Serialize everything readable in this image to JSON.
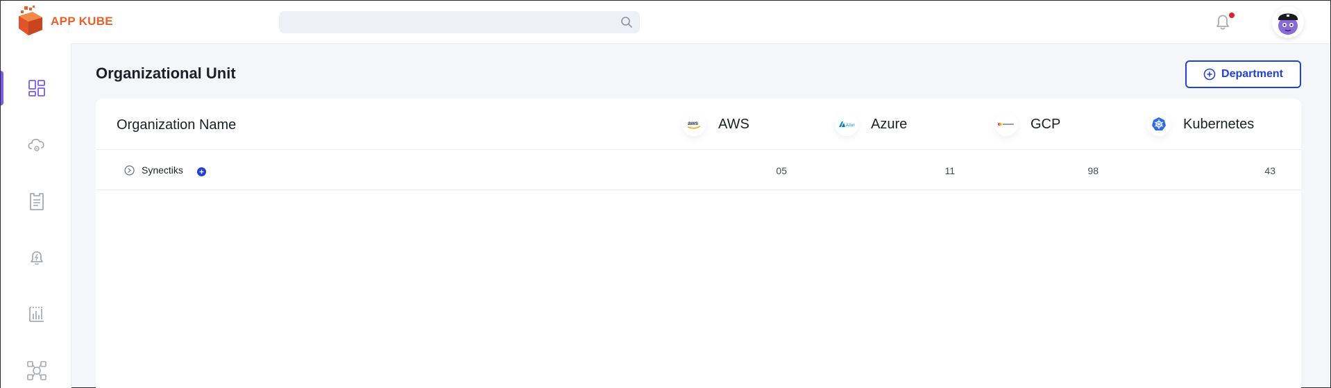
{
  "header": {
    "logo_text": "APP KUBE",
    "search": {
      "value": "",
      "placeholder": ""
    },
    "colors": {
      "brand": "#e8612c",
      "accent": "#2140d8",
      "notification": "#e3202e"
    }
  },
  "sidebar": {
    "items": [
      {
        "icon": "dashboard-icon",
        "active": true
      },
      {
        "icon": "cloud-icon",
        "active": false
      },
      {
        "icon": "clipboard-icon",
        "active": false
      },
      {
        "icon": "alert-bell-icon",
        "active": false
      },
      {
        "icon": "analytics-icon",
        "active": false
      },
      {
        "icon": "workflow-icon",
        "active": false
      }
    ]
  },
  "main": {
    "title": "Organizational Unit",
    "department_button_label": "Department",
    "table": {
      "columns": {
        "name": "Organization Name",
        "aws": "AWS",
        "azure": "Azure",
        "gcp": "GCP",
        "kubernetes": "Kubernetes"
      },
      "rows": [
        {
          "name": "Synectiks",
          "aws": "05",
          "azure": "11",
          "gcp": "98",
          "kubernetes": "43"
        }
      ]
    }
  }
}
